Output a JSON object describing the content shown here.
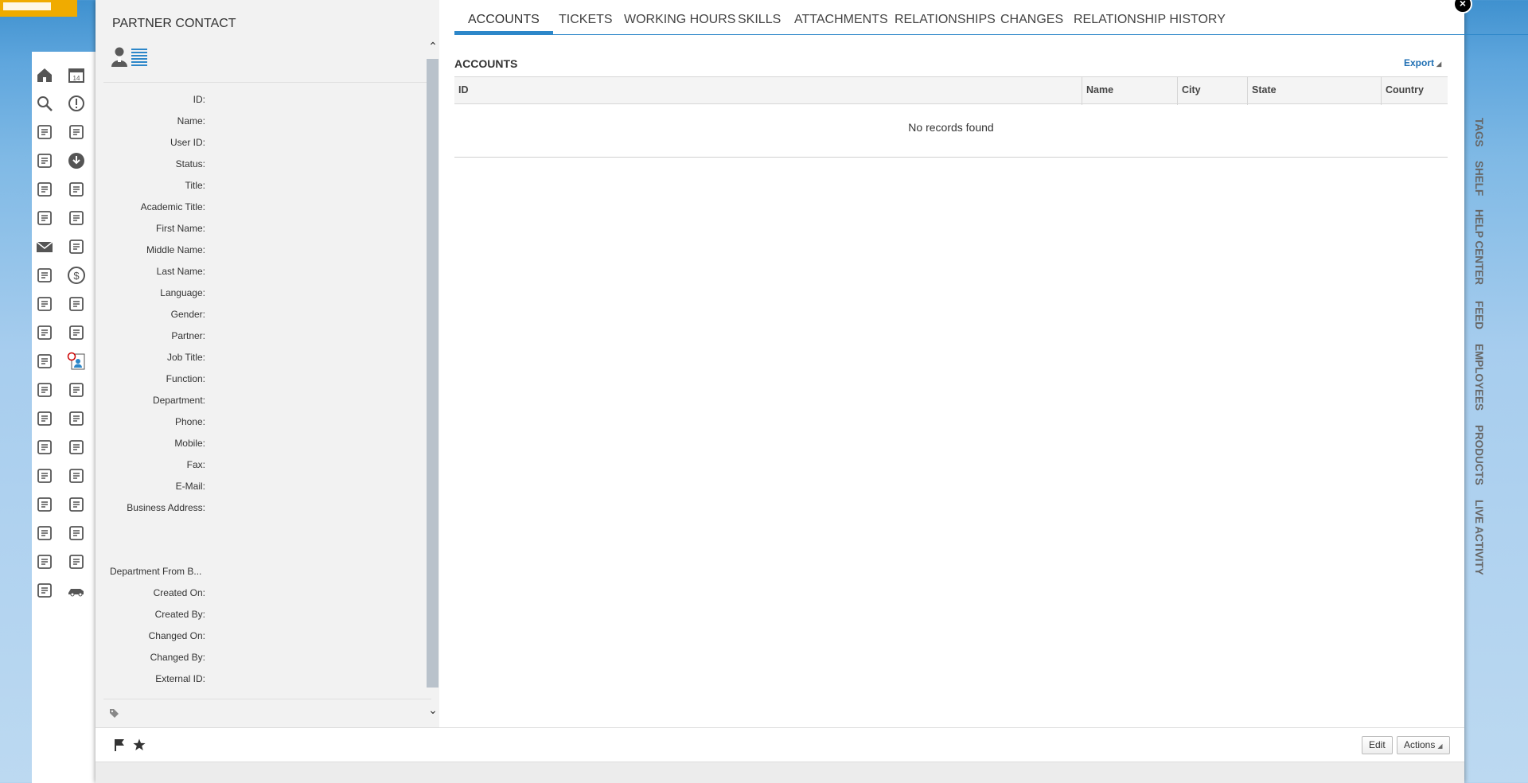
{
  "modal": {
    "title": "PARTNER CONTACT",
    "close_label": "×"
  },
  "fields": [
    {
      "label": "ID:"
    },
    {
      "label": "Name:"
    },
    {
      "label": "User ID:"
    },
    {
      "label": "Status:"
    },
    {
      "label": "Title:"
    },
    {
      "label": "Academic Title:"
    },
    {
      "label": "First Name:"
    },
    {
      "label": "Middle Name:"
    },
    {
      "label": "Last Name:"
    },
    {
      "label": "Language:"
    },
    {
      "label": "Gender:"
    },
    {
      "label": "Partner:"
    },
    {
      "label": "Job Title:"
    },
    {
      "label": "Function:"
    },
    {
      "label": "Department:"
    },
    {
      "label": "Phone:"
    },
    {
      "label": "Mobile:"
    },
    {
      "label": "Fax:"
    },
    {
      "label": "E-Mail:"
    },
    {
      "label": "Business Address:"
    },
    {
      "label": "Department From B..."
    },
    {
      "label": "Created On:"
    },
    {
      "label": "Created By:"
    },
    {
      "label": "Changed On:"
    },
    {
      "label": "Changed By:"
    },
    {
      "label": "External ID:"
    }
  ],
  "tabs": [
    {
      "label": "ACCOUNTS",
      "active": true
    },
    {
      "label": "TICKETS"
    },
    {
      "label": "WORKING HOURS"
    },
    {
      "label": "SKILLS"
    },
    {
      "label": "ATTACHMENTS"
    },
    {
      "label": "RELATIONSHIPS"
    },
    {
      "label": "CHANGES"
    },
    {
      "label": "RELATIONSHIP HISTORY"
    }
  ],
  "accounts": {
    "section_title": "ACCOUNTS",
    "export_label": "Export",
    "columns": [
      "ID",
      "Name",
      "City",
      "State",
      "Country"
    ],
    "empty_message": "No records found"
  },
  "footer": {
    "edit_label": "Edit",
    "actions_label": "Actions"
  },
  "right_sidebar": [
    "TAGS",
    "SHELF",
    "HELP CENTER",
    "FEED",
    "EMPLOYEES",
    "PRODUCTS",
    "LIVE ACTIVITY"
  ],
  "left_nav_icons": [
    "home-icon",
    "calendar-icon",
    "search-icon",
    "alert-icon",
    "org-people-icon",
    "hierarchy-icon",
    "product-box-icon",
    "download-icon",
    "analysis-icon",
    "contact-circle-icon",
    "person-list-icon",
    "team-building-icon",
    "mail-icon",
    "checklist-icon",
    "money-transfer-icon",
    "dollar-icon",
    "person-exchange-icon",
    "document-chart-icon",
    "calendar-clock-icon",
    "handshake-icon",
    "list-icon",
    "partner-contact-icon",
    "building-location-icon",
    "chat-list-icon",
    "location-person-icon",
    "notebook-icon",
    "price-tag-icon",
    "speed-icon",
    "map-pin-icon",
    "calendar-week-icon",
    "phone-grid-icon",
    "clipboard-check-icon",
    "calendar-star-icon",
    "timeline-icon",
    "clipboard-list-icon",
    "cube-icon",
    "report-icon",
    "car-icon"
  ],
  "colors": {
    "accent": "#2d87c9",
    "link": "#1f6fb3",
    "brand": "#f0ab00"
  }
}
